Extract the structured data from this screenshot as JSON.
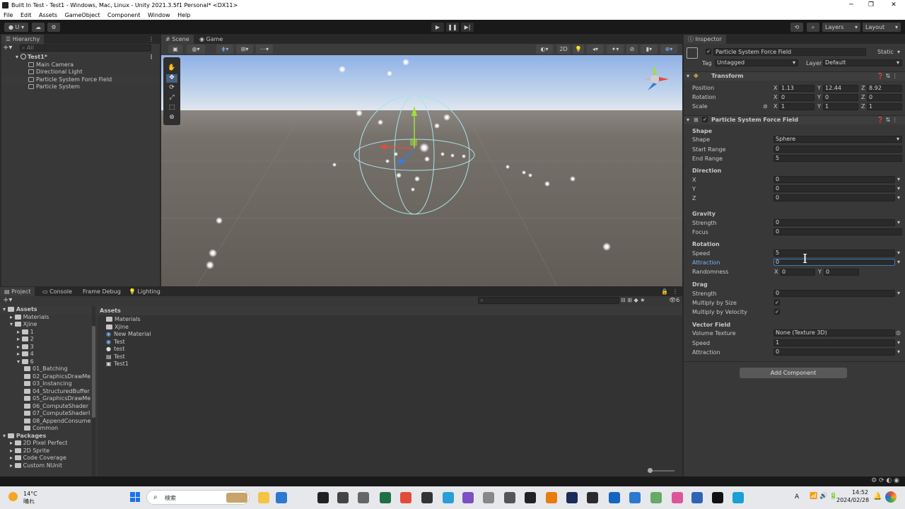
{
  "window": {
    "title": "Built In Test - Test1 - Windows, Mac, Linux - Unity 2021.3.5f1 Personal* <DX11>",
    "minimize": "─",
    "maximize": "❐",
    "close": "✕"
  },
  "menu": [
    "File",
    "Edit",
    "Assets",
    "GameObject",
    "Component",
    "Window",
    "Help"
  ],
  "toolbar": {
    "account": "U",
    "layers": "Layers",
    "layout": "Layout",
    "play": "▶",
    "pause": "❚❚",
    "step": "▶|"
  },
  "hierarchy": {
    "tab": "Hierarchy",
    "search_placeholder": "All",
    "scene": "Test1*",
    "items": [
      "Main Camera",
      "Directional Light",
      "Particle System Force Field",
      "Particle System"
    ]
  },
  "scene_view": {
    "tabs": [
      "Scene",
      "Game"
    ],
    "mode_2d": "2D"
  },
  "bottom_tabs": [
    "Project",
    "Console",
    "Frame Debug",
    "Lighting"
  ],
  "project": {
    "tree_assets": "Assets",
    "tree": [
      {
        "label": "Materials",
        "depth": 1
      },
      {
        "label": "Xjine",
        "depth": 1
      },
      {
        "label": "1",
        "depth": 2
      },
      {
        "label": "2",
        "depth": 2
      },
      {
        "label": "3",
        "depth": 2
      },
      {
        "label": "4",
        "depth": 2
      },
      {
        "label": "6",
        "depth": 2
      },
      {
        "label": "01_Batching",
        "depth": 3
      },
      {
        "label": "02_GraphicsDrawMe",
        "depth": 3
      },
      {
        "label": "03_Instancing",
        "depth": 3
      },
      {
        "label": "04_StructuredBuffer",
        "depth": 3
      },
      {
        "label": "05_GraphicsDrawMe",
        "depth": 3
      },
      {
        "label": "06_ComputeShader",
        "depth": 3
      },
      {
        "label": "07_ComputeShaderI",
        "depth": 3
      },
      {
        "label": "08_AppendConsume",
        "depth": 3
      },
      {
        "label": "Common",
        "depth": 3
      }
    ],
    "packages_label": "Packages",
    "packages": [
      "2D Pixel Perfect",
      "2D Sprite",
      "Code Coverage",
      "Custom NUnit"
    ],
    "breadcrumb": "Assets",
    "assets": [
      "Materials",
      "Xjine",
      "New Material",
      "Test",
      "test",
      "Test",
      "Test1"
    ],
    "count_badge": "6"
  },
  "inspector": {
    "tab": "Inspector",
    "object_name": "Particle System Force Field",
    "static_label": "Static",
    "tag_label": "Tag",
    "tag_value": "Untagged",
    "layer_label": "Layer",
    "layer_value": "Default",
    "transform": {
      "title": "Transform",
      "position_label": "Position",
      "rotation_label": "Rotation",
      "scale_label": "Scale",
      "position": {
        "x": "1.13",
        "y": "12.44",
        "z": "8.92"
      },
      "rotation": {
        "x": "0",
        "y": "0",
        "z": "0"
      },
      "scale": {
        "x": "1",
        "y": "1",
        "z": "1"
      }
    },
    "component_title": "Particle System Force Field",
    "shape_section": "Shape",
    "shape_label": "Shape",
    "shape_value": "Sphere",
    "start_range_label": "Start Range",
    "start_range": "0",
    "end_range_label": "End Range",
    "end_range": "5",
    "direction_section": "Direction",
    "dir_x_label": "X",
    "dir_x": "0",
    "dir_y_label": "Y",
    "dir_y": "0",
    "dir_z_label": "Z",
    "dir_z": "0",
    "gravity_section": "Gravity",
    "gravity_strength_label": "Strength",
    "gravity_strength": "0",
    "gravity_focus_label": "Focus",
    "gravity_focus": "0",
    "rotation_section": "Rotation",
    "rot_speed_label": "Speed",
    "rot_speed": "5",
    "rot_attraction_label": "Attraction",
    "rot_attraction": "0",
    "rot_randomness_label": "Randomness",
    "rand_x": "0",
    "rand_y": "0",
    "drag_section": "Drag",
    "drag_strength_label": "Strength",
    "drag_strength": "0",
    "multiply_size_label": "Multiply by Size",
    "multiply_velocity_label": "Multiply by Velocity",
    "vector_section": "Vector Field",
    "volume_texture_label": "Volume Texture",
    "volume_texture": "None (Texture 3D)",
    "vf_speed_label": "Speed",
    "vf_speed": "1",
    "vf_attraction_label": "Attraction",
    "vf_attraction": "0",
    "add_component": "Add Component",
    "axis_x": "X",
    "axis_y": "Y",
    "axis_z": "Z"
  },
  "taskbar": {
    "weather_temp": "14°C",
    "weather_desc": "晴れ",
    "search_placeholder": "検索",
    "time": "14:52",
    "date": "2024/02/28",
    "ime": "A"
  }
}
